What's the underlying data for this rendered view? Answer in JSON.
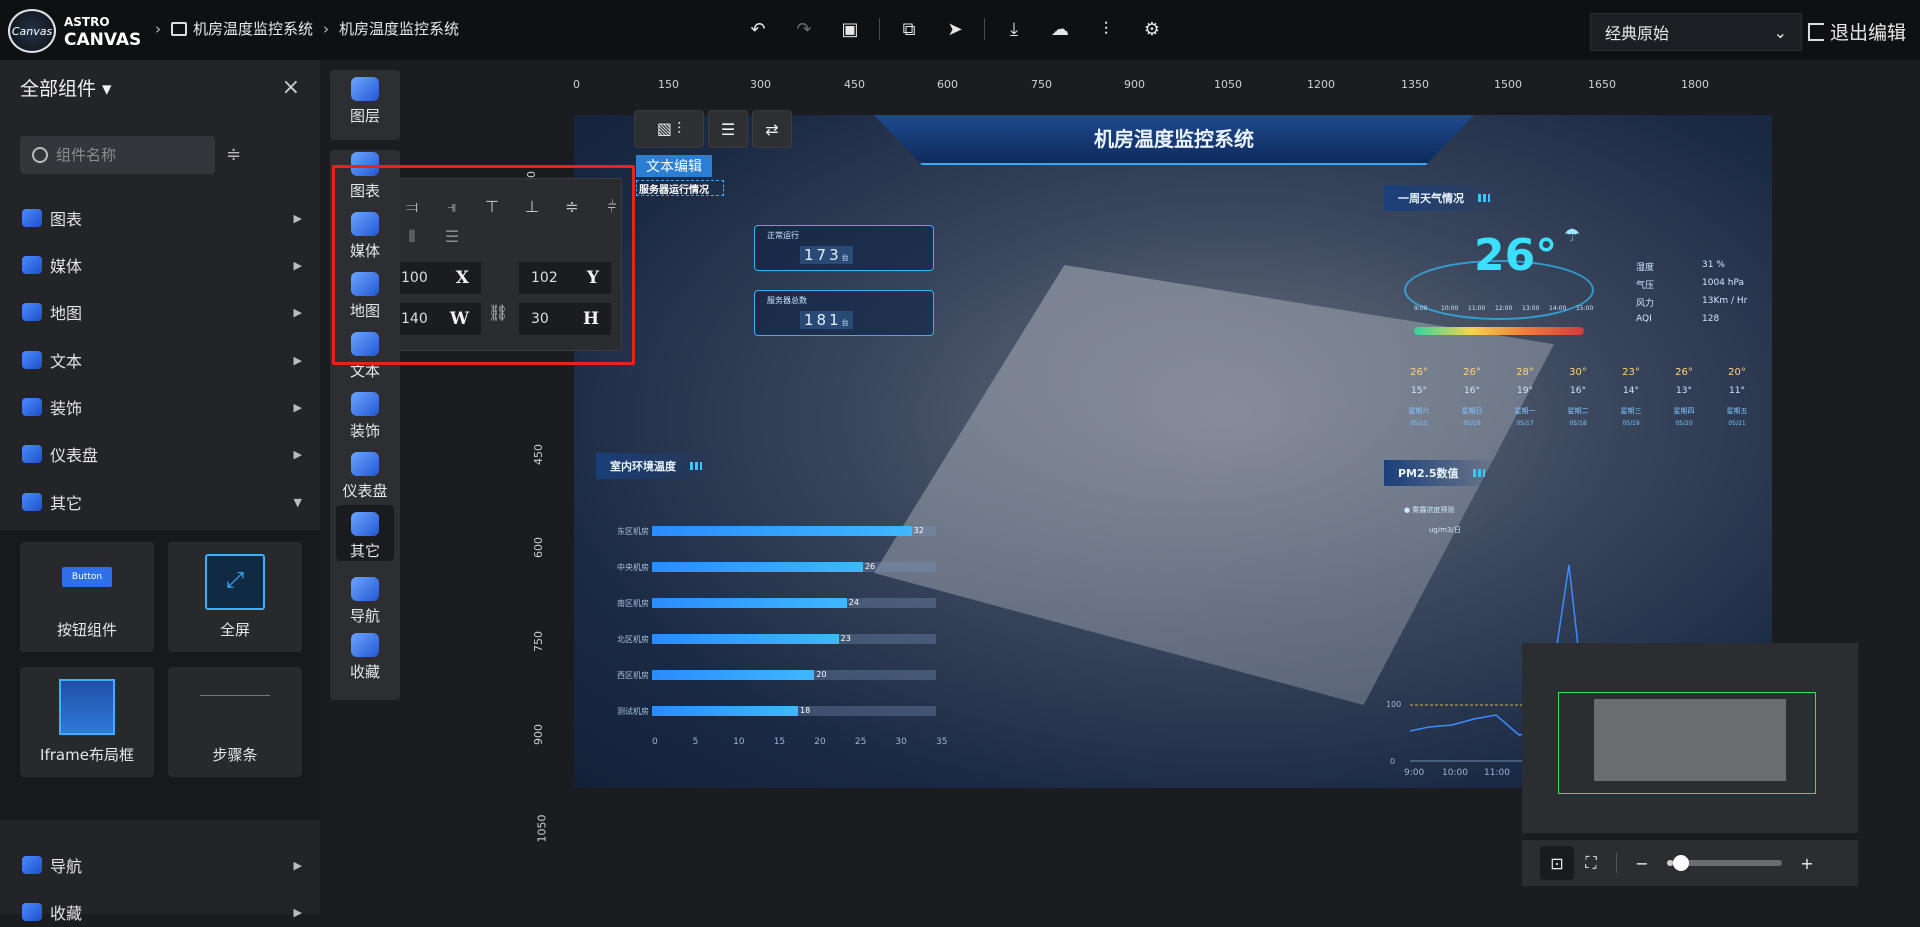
{
  "app": {
    "logo_top": "ASTRO",
    "logo_bottom": "CANVAS",
    "logo_circle": "Canvas"
  },
  "breadcrumb": [
    "机房温度监控系统",
    "机房温度监控系统"
  ],
  "theme_select": {
    "value": "经典原始"
  },
  "exit_label": "退出编辑",
  "sidebar": {
    "title": "全部组件",
    "search_placeholder": "组件名称",
    "categories": [
      "图表",
      "媒体",
      "地图",
      "文本",
      "装饰",
      "仪表盘",
      "其它",
      "导航",
      "收藏"
    ],
    "tiles": [
      {
        "label": "按钮组件",
        "preview": "Button"
      },
      {
        "label": "全屏"
      },
      {
        "label": "Iframe布局框"
      },
      {
        "label": "步骤条"
      }
    ]
  },
  "vtoolbar": [
    "图层",
    "图表",
    "媒体",
    "地图",
    "文本",
    "装饰",
    "仪表盘",
    "其它",
    "导航",
    "收藏"
  ],
  "ruler": {
    "top": [
      "0",
      "150",
      "300",
      "450",
      "600",
      "750",
      "900",
      "1050",
      "1200",
      "1350",
      "1500",
      "1650",
      "1800"
    ],
    "left": [
      "0",
      "450",
      "600",
      "750",
      "900",
      "1050"
    ]
  },
  "selection": {
    "text_edit_label": "文本编辑",
    "selected_text": "服务器运行情况"
  },
  "props": {
    "x": "100",
    "x_label": "X",
    "y": "102",
    "y_label": "Y",
    "w": "140",
    "w_label": "W",
    "h": "30",
    "h_label": "H"
  },
  "dashboard": {
    "title": "机房温度监控系统",
    "stats": [
      {
        "label": "正常运行",
        "value": "173",
        "unit": "台"
      },
      {
        "label": "服务器总数",
        "value": "181",
        "unit": "台"
      }
    ],
    "env_panel_title": "室内环境温度",
    "env_bars": [
      {
        "label": "东区机房",
        "value": 32
      },
      {
        "label": "中央机房",
        "value": 26
      },
      {
        "label": "南区机房",
        "value": 24
      },
      {
        "label": "北区机房",
        "value": 23
      },
      {
        "label": "西区机房",
        "value": 20
      },
      {
        "label": "测试机房",
        "value": 18
      }
    ],
    "env_xticks": [
      "0",
      "5",
      "10",
      "15",
      "20",
      "25",
      "30",
      "35"
    ],
    "weather_title": "一周天气情况",
    "weather_temp": "26°",
    "weather_hours": [
      "9:00",
      "10:00",
      "11:00",
      "12:00",
      "13:00",
      "14:00",
      "15:00"
    ],
    "weather_kv": [
      {
        "k": "湿度",
        "v": "31 %"
      },
      {
        "k": "气压",
        "v": "1004 hPa"
      },
      {
        "k": "风力",
        "v": "13Km / Hr"
      },
      {
        "k": "AQI",
        "v": "128"
      }
    ],
    "forecast": [
      {
        "hi": "26°",
        "lo": "15°",
        "wd": "星期六",
        "dt": "05/15"
      },
      {
        "hi": "26°",
        "lo": "16°",
        "wd": "星期日",
        "dt": "05/16"
      },
      {
        "hi": "28°",
        "lo": "19°",
        "wd": "星期一",
        "dt": "05/17"
      },
      {
        "hi": "30°",
        "lo": "16°",
        "wd": "星期二",
        "dt": "05/18"
      },
      {
        "hi": "23°",
        "lo": "14°",
        "wd": "星期三",
        "dt": "05/19"
      },
      {
        "hi": "26°",
        "lo": "13°",
        "wd": "星期四",
        "dt": "05/20"
      },
      {
        "hi": "20°",
        "lo": "11°",
        "wd": "星期五",
        "dt": "05/21"
      }
    ],
    "pm_title": "PM2.5数值",
    "pm_legend": "雾霾浓度预测",
    "pm_unit": "ug/m3/日",
    "pm_xticks": [
      "9:00",
      "10:00",
      "11:00"
    ],
    "pm_yticks": [
      "0",
      "100"
    ]
  },
  "zoom": {
    "level": 0.05
  },
  "colors": {
    "accent": "#2a7fd4",
    "highlight_red": "#e5241a",
    "minimap_frame": "#3be05a"
  }
}
